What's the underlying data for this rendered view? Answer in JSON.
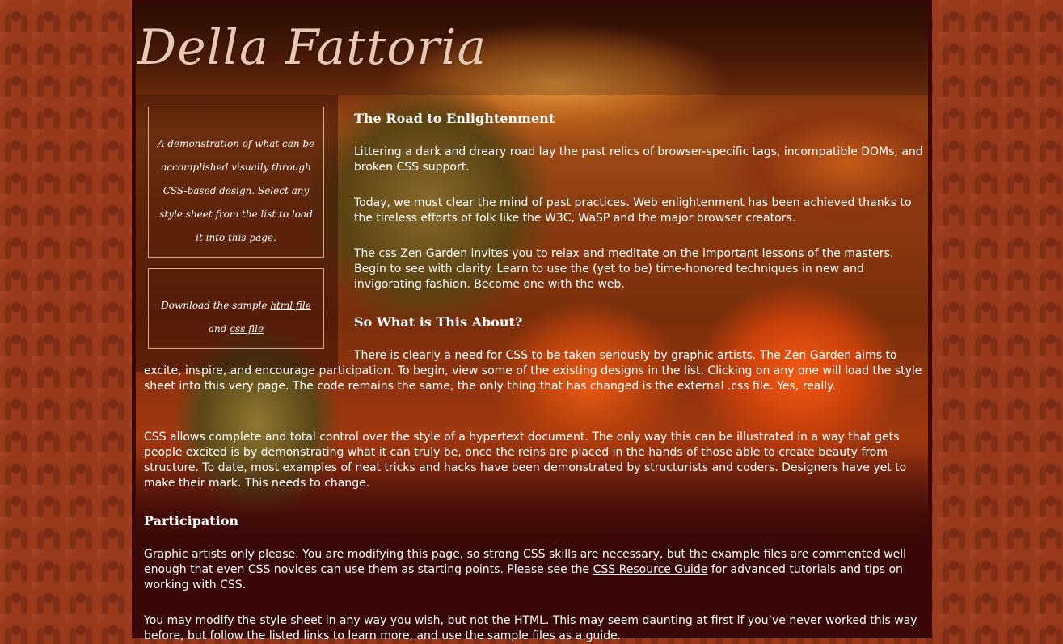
{
  "logo": {
    "text": "Della Fattoria"
  },
  "sidebar": {
    "intro": "A demonstration of what can be accomplished visually through CSS-based design. Select any style sheet from the list to load it into this page.",
    "download": {
      "prefix": "Download the sample",
      "html_link": "html file",
      "and": "and",
      "css_link": "css file"
    }
  },
  "sections": {
    "road": {
      "title": "The Road to Enlightenment",
      "p1": "Littering a dark and dreary road lay the past relics of browser-specific tags, incompatible DOMs, and broken CSS support.",
      "p2": "Today, we must clear the mind of past practices. Web enlightenment has been achieved thanks to the tireless efforts of folk like the W3C, WaSP and the major browser creators.",
      "p3": "The css Zen Garden invites you to relax and meditate on the important lessons of the masters. Begin to see with clarity. Learn to use the (yet to be) time-honored techniques in new and invigorating fashion. Become one with the web."
    },
    "about": {
      "title": "So What is This About?",
      "p1": "There is clearly a need for CSS to be taken seriously by graphic artists. The Zen Garden aims to excite, inspire, and encourage participation. To begin, view some of the existing designs in the list. Clicking on any one will load the style sheet into this very page. The code remains the same, the only thing that has changed is the external .css file. Yes, really.",
      "p2": "CSS allows complete and total control over the style of a hypertext document. The only way this can be illustrated in a way that gets people excited is by demonstrating what it can truly be, once the reins are placed in the hands of those able to create beauty from structure. To date, most examples of neat tricks and hacks have been demonstrated by structurists and coders. Designers have yet to make their mark. This needs to change."
    },
    "participation": {
      "title": "Participation",
      "p1_before": "Graphic artists only please. You are modifying this page, so strong CSS skills are necessary, but the example files are commented well enough that even CSS novices can use them as starting points. Please see the",
      "p1_link": "CSS Resource Guide",
      "p1_after": "for advanced tutorials and tips on working with CSS.",
      "p2": "You may modify the style sheet in any way you wish, but not the HTML. This may seem daunting at first if you’ve never worked this way before, but follow the listed links to learn more, and use the sample files as a guide."
    }
  }
}
